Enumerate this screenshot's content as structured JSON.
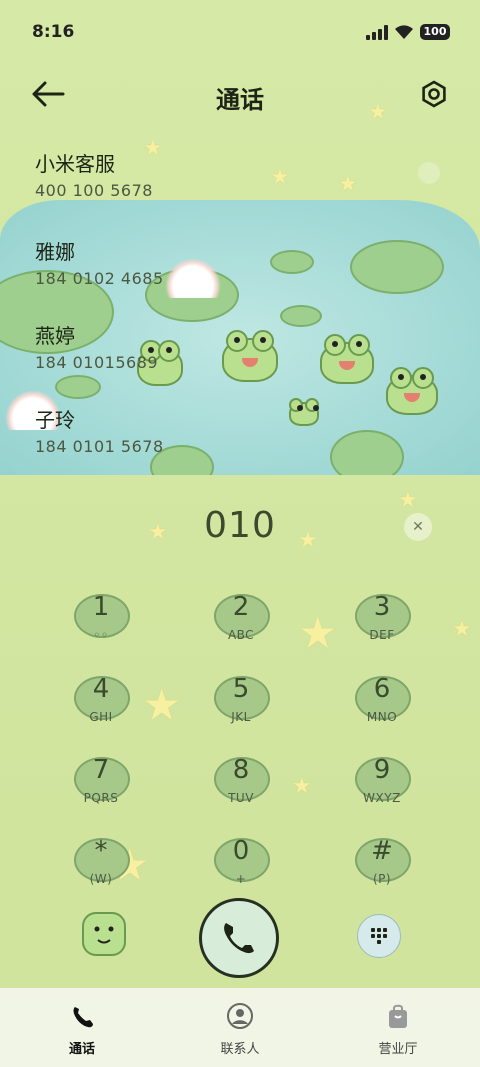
{
  "status_bar": {
    "time": "8:16",
    "battery": "100"
  },
  "header": {
    "title": "通话"
  },
  "call_log": [
    {
      "name": "小米客服",
      "number": "400 100 5678"
    },
    {
      "name": "雅娜",
      "number": "184 0102 4685"
    },
    {
      "name": "燕婷",
      "number": "184 01015689"
    },
    {
      "name": "子玲",
      "number": "184 0101 5678"
    }
  ],
  "dialer": {
    "input": "010",
    "keys": [
      {
        "digit": "1",
        "letters": ""
      },
      {
        "digit": "2",
        "letters": "ABC"
      },
      {
        "digit": "3",
        "letters": "DEF"
      },
      {
        "digit": "4",
        "letters": "GHI"
      },
      {
        "digit": "5",
        "letters": "JKL"
      },
      {
        "digit": "6",
        "letters": "MNO"
      },
      {
        "digit": "7",
        "letters": "PQRS"
      },
      {
        "digit": "8",
        "letters": "TUV"
      },
      {
        "digit": "9",
        "letters": "WXYZ"
      },
      {
        "digit": "*",
        "letters": "(W)"
      },
      {
        "digit": "0",
        "letters": "+"
      },
      {
        "digit": "#",
        "letters": "(P)"
      }
    ]
  },
  "tabs": [
    {
      "label": "通话",
      "icon": "phone-icon",
      "active": true
    },
    {
      "label": "联系人",
      "icon": "contact-icon",
      "active": false
    },
    {
      "label": "营业厅",
      "icon": "bag-icon",
      "active": false
    }
  ]
}
